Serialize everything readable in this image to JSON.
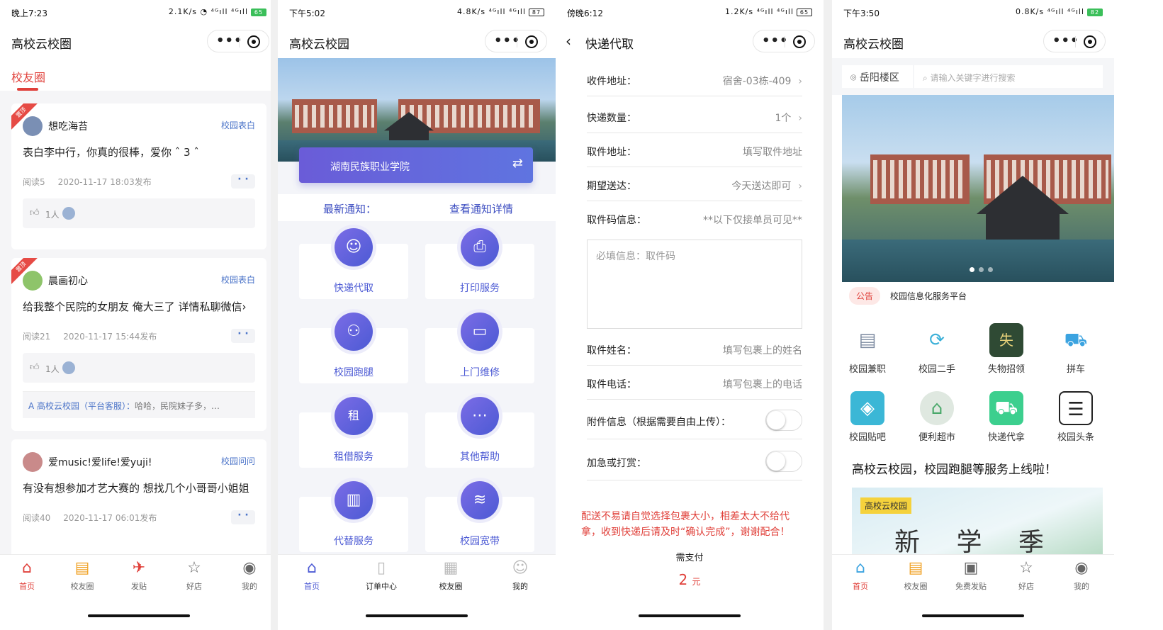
{
  "phone1": {
    "status": {
      "time": "晚上7:23",
      "right": "2.1K/s ◔ ⁴ᴳıll ⁴ᴳıll",
      "battery": "65"
    },
    "title": "高校云校圈",
    "tab": "校友圈",
    "posts": [
      {
        "ribbon": "置顶",
        "name": "想吃海苔",
        "tag": "校园表白",
        "body": "表白李中行，你真的很棒，爱你 ˆ 3 ˆ",
        "reads": "阅读5",
        "time": "2020-11-17 18:03发布",
        "likes": "1人"
      },
      {
        "ribbon": "置顶",
        "name": "晨画初心",
        "tag": "校园表白",
        "body": "给我整个民院的女朋友 俺大三了 详情私聊微信›",
        "reads": "阅读21",
        "time": "2020-11-17 15:44发布",
        "likes": "1人",
        "comment_author": "A 高校云校园（平台客服）：",
        "comment_text": "哈哈，民院妹子多，…"
      },
      {
        "ribbon": "",
        "name": "爱music!爱life!爱yuji!",
        "tag": "校园问问",
        "body": "有没有想参加才艺大赛的 想找几个小哥哥小姐姐",
        "reads": "阅读40",
        "time": "2020-11-17 06:01发布"
      }
    ],
    "tabbar": [
      {
        "icon": "⌂",
        "label": "首页"
      },
      {
        "icon": "▤",
        "label": "校友圈"
      },
      {
        "icon": "✈",
        "label": "发贴"
      },
      {
        "icon": "☆",
        "label": "好店"
      },
      {
        "icon": "◉",
        "label": "我的"
      }
    ]
  },
  "phone2": {
    "status": {
      "time": "下午5:02",
      "right": "4.8K/s ⁴ᴳıll ⁴ᴳıll",
      "battery": "87"
    },
    "title": "高校云校园",
    "school": "湖南民族职业学院",
    "switch_icon": "⇄",
    "notice_left": "最新通知：",
    "notice_right": "查看通知详情",
    "services": [
      {
        "icon": "☺",
        "label": "快递代取"
      },
      {
        "icon": "⎙",
        "label": "打印服务"
      },
      {
        "icon": "⚇",
        "label": "校园跑腿"
      },
      {
        "icon": "▭",
        "label": "上门维修"
      },
      {
        "icon": "租",
        "label": "租借服务"
      },
      {
        "icon": "⋯",
        "label": "其他帮助"
      },
      {
        "icon": "▥",
        "label": "代替服务"
      },
      {
        "icon": "≋",
        "label": "校园宽带"
      }
    ],
    "tabbar": [
      {
        "icon": "⌂",
        "label": "首页"
      },
      {
        "icon": "▯",
        "label": "订单中心"
      },
      {
        "icon": "▦",
        "label": "校友圈"
      },
      {
        "icon": "☺",
        "label": "我的"
      }
    ]
  },
  "phone3": {
    "status": {
      "time": "傍晚6:12",
      "right": "1.2K/s ⁴ᴳıll ⁴ᴳıll",
      "battery": "65"
    },
    "title": "快递代取",
    "rows": [
      {
        "key": "收件地址：",
        "value": "宿舍-03栋-409",
        "chevron": "›"
      },
      {
        "key": "快递数量：",
        "value": "1个",
        "chevron": "›"
      },
      {
        "key": "取件地址：",
        "value": "填写取件地址",
        "chevron": ""
      },
      {
        "key": "期望送达：",
        "value": "今天送达即可",
        "chevron": "›"
      },
      {
        "key": "取件码信息：",
        "value": "**以下仅接单员可见**",
        "chevron": ""
      }
    ],
    "textarea_placeholder": "必填信息：取件码",
    "rows2": [
      {
        "key": "取件姓名：",
        "value": "填写包裹上的姓名"
      },
      {
        "key": "取件电话：",
        "value": "填写包裹上的电话"
      }
    ],
    "toggles": [
      {
        "label": "附件信息（根据需要自由上传）："
      },
      {
        "label": "加急或打赏："
      }
    ],
    "warning": "配送不易请自觉选择包裹大小，相差太大不给代拿，收到快递后请及时“确认完成”，谢谢配合！",
    "pay_label": "需支付",
    "amount": "2",
    "unit": "元"
  },
  "phone4": {
    "status": {
      "time": "下午3:50",
      "right": "0.8K/s ⁴ᴳıll ⁴ᴳıll",
      "battery": "82"
    },
    "title": "高校云校圈",
    "location": "岳阳楼区",
    "search_placeholder": "请输入关键字进行搜索",
    "notice_pill": "公告",
    "notice_text": "校园信息化服务平台",
    "grid": [
      {
        "icon": "▤",
        "label": "校园兼职",
        "color": "#7c8aa0"
      },
      {
        "icon": "⟳",
        "label": "校园二手",
        "color": "#3bb0d8"
      },
      {
        "icon": "失",
        "label": "失物招领",
        "color": "#2f5a3a"
      },
      {
        "icon": "⛟",
        "label": "拼车",
        "color": "#3ba3e0"
      },
      {
        "icon": "◈",
        "label": "校园贴吧",
        "color": "#3bb7d6"
      },
      {
        "icon": "⌂",
        "label": "便利超市",
        "color": "#49a86a"
      },
      {
        "icon": "⛟",
        "label": "快递代拿",
        "color": "#3ccf8e"
      },
      {
        "icon": "☰",
        "label": "校园头条",
        "color": "#222222"
      }
    ],
    "headline": "高校云校园，校园跑腿等服务上线啦！",
    "promo_tag": "高校云校园",
    "promo_big": "新 学 季",
    "tabbar": [
      {
        "icon": "⌂",
        "label": "首页"
      },
      {
        "icon": "▤",
        "label": "校友圈"
      },
      {
        "icon": "▣",
        "label": "免费发贴"
      },
      {
        "icon": "☆",
        "label": "好店"
      },
      {
        "icon": "◉",
        "label": "我的"
      }
    ]
  },
  "colors": {
    "accent_red": "#e0403a",
    "accent_blue": "#4c5ad4",
    "link_blue": "#4a73c8"
  }
}
